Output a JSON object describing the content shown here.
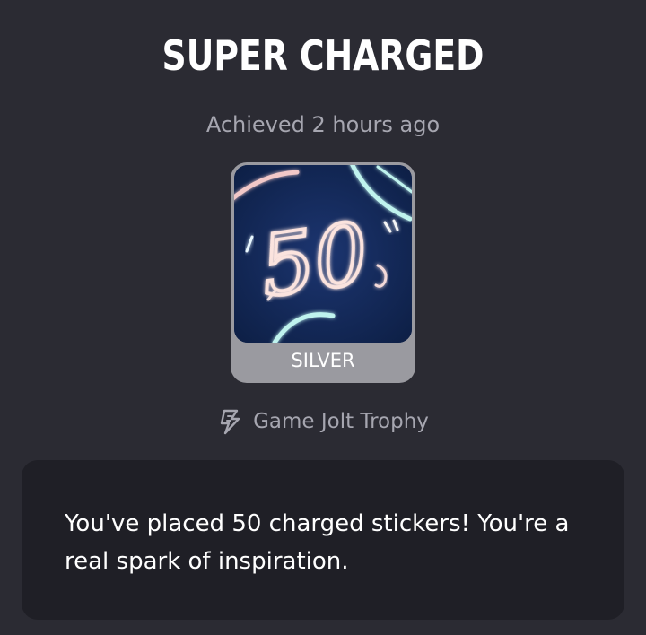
{
  "trophy": {
    "title": "SUPER CHARGED",
    "achieved": "Achieved 2 hours ago",
    "tier": "SILVER",
    "image_text": "50",
    "source": "Game Jolt Trophy",
    "description": "You've placed 50 charged stickers! You're a real spark of inspiration."
  },
  "icons": {
    "source_icon": "lightning-bolt-icon"
  },
  "colors": {
    "background": "#2b2b33",
    "card": "#1f1f26",
    "silver": "#9a9aa0",
    "muted_text": "#a6a6b0",
    "trophy_bg": "#142a57"
  }
}
